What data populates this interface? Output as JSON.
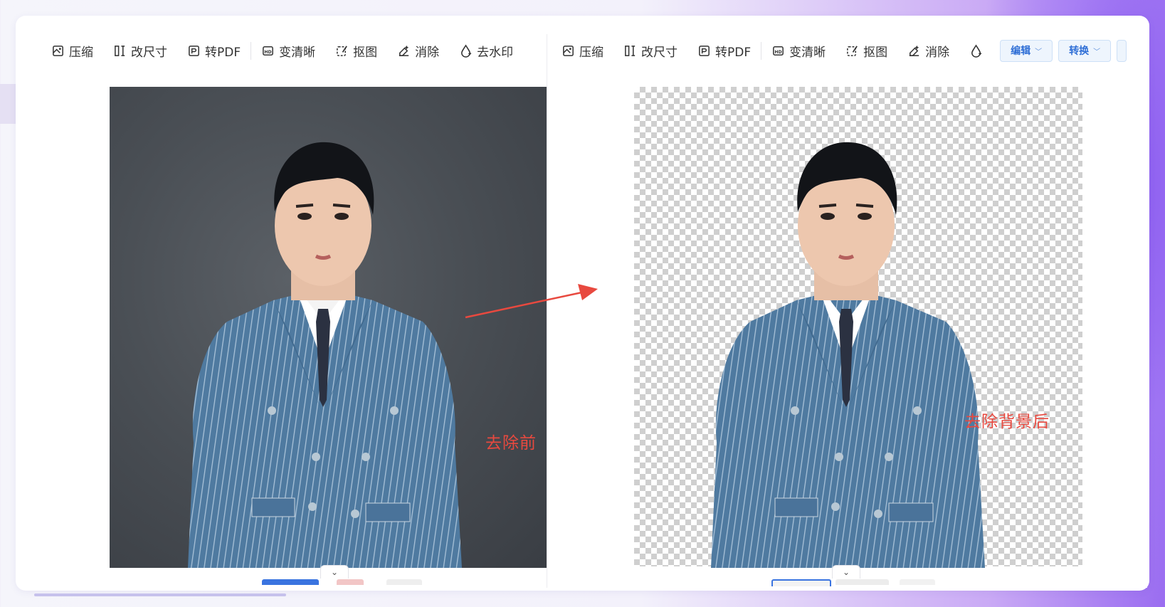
{
  "left_panel": {
    "tools": [
      {
        "label": "压缩",
        "icon": "compress-icon"
      },
      {
        "label": "改尺寸",
        "icon": "resize-icon"
      },
      {
        "label": "转PDF",
        "icon": "pdf-icon"
      },
      {
        "label": "变清晰",
        "icon": "hd-icon"
      },
      {
        "label": "抠图",
        "icon": "cutout-icon"
      },
      {
        "label": "消除",
        "icon": "eraser-icon"
      },
      {
        "label": "去水印",
        "icon": "watermark-icon"
      }
    ],
    "caption": "去除前"
  },
  "right_panel": {
    "tools": [
      {
        "label": "压缩",
        "icon": "compress-icon"
      },
      {
        "label": "改尺寸",
        "icon": "resize-icon"
      },
      {
        "label": "转PDF",
        "icon": "pdf-icon"
      },
      {
        "label": "变清晰",
        "icon": "hd-icon"
      },
      {
        "label": "抠图",
        "icon": "cutout-icon"
      },
      {
        "label": "消除",
        "icon": "eraser-icon"
      },
      {
        "label": "",
        "icon": "watermark-icon"
      }
    ],
    "edit_dropdown": "编辑",
    "convert_dropdown": "转换",
    "caption": "去除背景后"
  },
  "colors": {
    "accent": "#2f6fd6",
    "caption": "#e8493f",
    "arrow": "#e8493f",
    "suit": "#4f7aa0"
  }
}
